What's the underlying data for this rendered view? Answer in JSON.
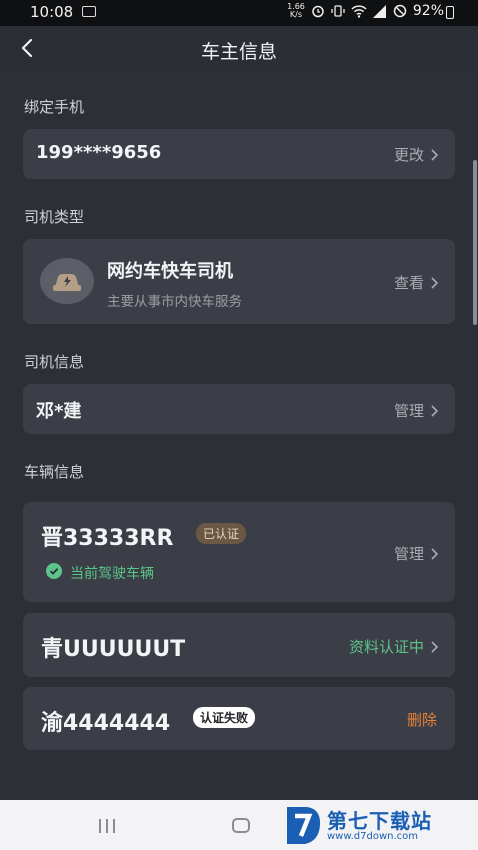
{
  "status_bar": {
    "time": "10:08",
    "speed_value": "1.66",
    "speed_unit": "K/s",
    "battery": "92%"
  },
  "nav": {
    "title": "车主信息"
  },
  "phone": {
    "section_label": "绑定手机",
    "number": "199****9656",
    "action": "更改"
  },
  "driver_type": {
    "section_label": "司机类型",
    "title": "网约车快车司机",
    "subtitle": "主要从事市内快车服务",
    "action": "查看"
  },
  "driver_info": {
    "section_label": "司机信息",
    "name": "邓*建",
    "action": "管理"
  },
  "vehicles": {
    "section_label": "车辆信息",
    "items": [
      {
        "plate": "晋33333RR",
        "badge": "已认证",
        "current_label": "当前驾驶车辆",
        "action": "管理"
      },
      {
        "plate": "青UUUUUUT",
        "action": "资料认证中"
      },
      {
        "plate": "渝4444444",
        "badge": "认证失败",
        "action": "删除"
      }
    ]
  },
  "watermark": {
    "text": "第七下载站",
    "url": "www.d7down.com"
  },
  "colors": {
    "background": "#2c2f36",
    "card": "#3b3e46",
    "green": "#5cc48a",
    "orange": "#e8823a",
    "badge_gold": "#6a5744",
    "accent_blue": "#1a5fb4"
  }
}
